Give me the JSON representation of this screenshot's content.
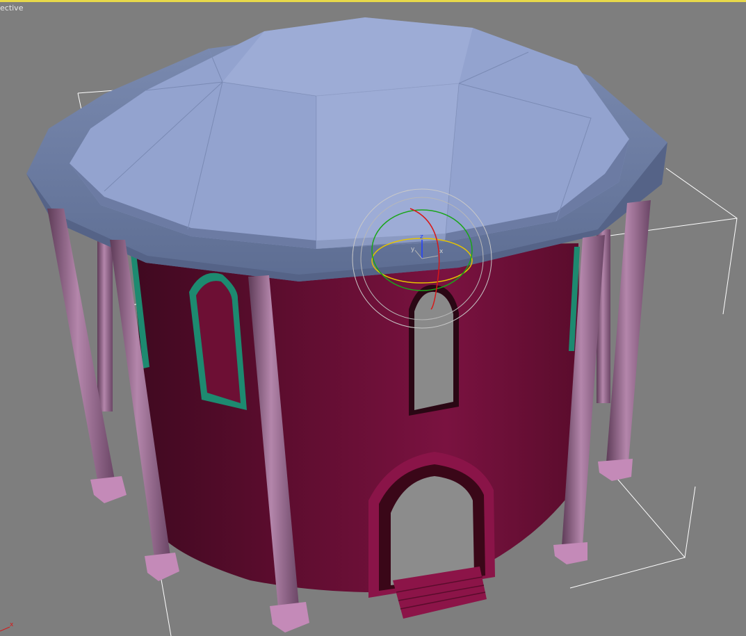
{
  "viewport": {
    "label": "ective",
    "active_border_color": "#e8d94a",
    "background_color": "#7e7e7e"
  },
  "gizmo": {
    "axis_z_label": "z",
    "axis_x_label": "x",
    "axis_y_label": "y"
  },
  "corner_axis": {
    "x_label": "x"
  },
  "scene_colors": {
    "dome": "#8f9fca",
    "wall": "#6e1035",
    "column": "#9a6a8e",
    "window_frame": "#1a7a63",
    "bounding_box": "#ffffff"
  }
}
